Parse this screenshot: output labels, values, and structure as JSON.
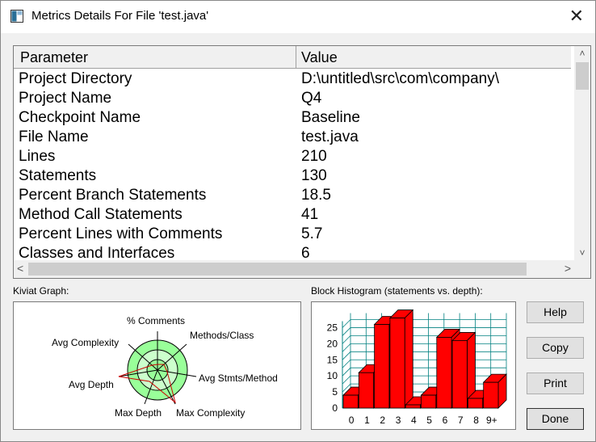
{
  "window": {
    "title": "Metrics Details For File 'test.java'",
    "close_glyph": "✕"
  },
  "table": {
    "headers": [
      "Parameter",
      "Value"
    ],
    "rows": [
      {
        "param": "Project Directory",
        "value": "D:\\untitled\\src\\com\\company\\"
      },
      {
        "param": "Project Name",
        "value": "Q4"
      },
      {
        "param": "Checkpoint Name",
        "value": "Baseline"
      },
      {
        "param": "File Name",
        "value": "test.java"
      },
      {
        "param": "Lines",
        "value": "210"
      },
      {
        "param": "Statements",
        "value": "130"
      },
      {
        "param": "Percent Branch Statements",
        "value": "18.5"
      },
      {
        "param": "Method Call Statements",
        "value": "41"
      },
      {
        "param": "Percent Lines with Comments",
        "value": "5.7"
      },
      {
        "param": "Classes and Interfaces",
        "value": "6"
      }
    ]
  },
  "kiviat": {
    "label": "Kiviat Graph:",
    "axes": [
      "% Comments",
      "Methods/Class",
      "Avg Stmts/Method",
      "Max Complexity",
      "Max Depth",
      "Avg Depth",
      "Avg Complexity"
    ],
    "colors": {
      "outer": "#99ff99",
      "inner": "#ccffcc",
      "stroke": "#000000",
      "polygon": "#cc0000"
    }
  },
  "histogram": {
    "label": "Block Histogram (statements vs. depth):",
    "bar_color": "#ff0000",
    "grid_color": "#008080"
  },
  "chart_data": {
    "type": "bar",
    "categories": [
      "0",
      "1",
      "2",
      "3",
      "4",
      "5",
      "6",
      "7",
      "8",
      "9+"
    ],
    "values": [
      4,
      11,
      26,
      28,
      1,
      4,
      22,
      21,
      3,
      8
    ],
    "ylim": [
      0,
      27
    ],
    "yticks": [
      "0",
      "5",
      "10",
      "15",
      "20",
      "25"
    ],
    "grid": true
  },
  "buttons": {
    "help": "Help",
    "copy": "Copy",
    "print": "Print",
    "done": "Done"
  },
  "scroll": {
    "up": "˄",
    "down": "˅",
    "left": "<",
    "right": ">"
  }
}
